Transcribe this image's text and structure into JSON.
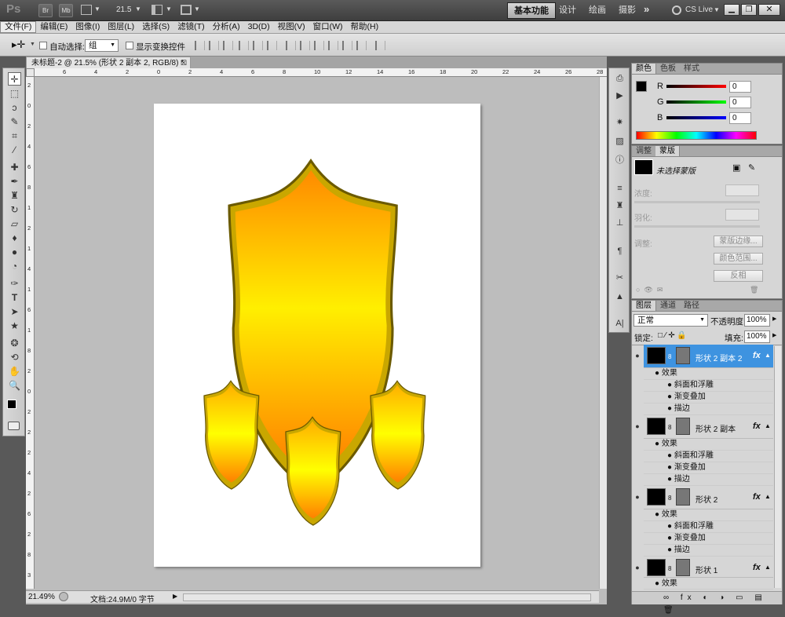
{
  "app": {
    "logo": "Ps",
    "zoom_display": "21.5",
    "cslive": "CS Live"
  },
  "topbar_buttons": [
    "Br",
    "Mb"
  ],
  "workspaces": [
    {
      "label": "基本功能",
      "active": true
    },
    {
      "label": "设计",
      "active": false
    },
    {
      "label": "绘画",
      "active": false
    },
    {
      "label": "摄影",
      "active": false
    }
  ],
  "menu": [
    "文件(F)",
    "编辑(E)",
    "图像(I)",
    "图层(L)",
    "选择(S)",
    "滤镜(T)",
    "分析(A)",
    "3D(D)",
    "视图(V)",
    "窗口(W)",
    "帮助(H)"
  ],
  "options": {
    "auto_select_label": "自动选择:",
    "auto_select_value": "组",
    "show_transform_label": "显示变换控件"
  },
  "document": {
    "tab_title": "未标题-2 @ 21.5% (形状 2 副本 2, RGB/8) *"
  },
  "rulers": {
    "h_ticks": [
      "6",
      "4",
      "2",
      "0",
      "2",
      "4",
      "6",
      "8",
      "10",
      "12",
      "14",
      "16",
      "18",
      "20",
      "22",
      "24",
      "26",
      "28"
    ],
    "v_ticks": [
      "2",
      "0",
      "2",
      "4",
      "6",
      "8",
      "1",
      "2",
      "1",
      "4",
      "1",
      "6",
      "1",
      "8",
      "2",
      "0",
      "2",
      "2",
      "2",
      "4",
      "2",
      "6",
      "2",
      "8",
      "3"
    ]
  },
  "status": {
    "zoom": "21.49%",
    "doc": "文档:24.9M/0 字节"
  },
  "color_panel": {
    "tabs": [
      {
        "label": "颜色",
        "active": true
      },
      {
        "label": "色板",
        "active": false
      },
      {
        "label": "样式",
        "active": false
      }
    ],
    "channels": [
      {
        "label": "R",
        "value": "0",
        "color": "#e00000"
      },
      {
        "label": "G",
        "value": "0",
        "color": "#00b000"
      },
      {
        "label": "B",
        "value": "0",
        "color": "#0000d0"
      }
    ]
  },
  "mask_panel": {
    "tabs": [
      {
        "label": "调整",
        "active": false
      },
      {
        "label": "蒙版",
        "active": true
      }
    ],
    "no_mask": "未选择蒙版",
    "density": "浓度:",
    "feather": "羽化:",
    "refine": "调整:",
    "buttons": [
      "蒙版边缘...",
      "颜色范围...",
      "反相"
    ]
  },
  "layers_panel": {
    "tabs": [
      {
        "label": "图层",
        "active": true
      },
      {
        "label": "通道",
        "active": false
      },
      {
        "label": "路径",
        "active": false
      }
    ],
    "blend_mode": "正常",
    "opacity_label": "不透明度:",
    "opacity": "100%",
    "lock_label": "锁定:",
    "fill_label": "填充:",
    "fill": "100%",
    "layers": [
      {
        "name": "形状 2 副本 2",
        "selected": true,
        "effects_label": "效果",
        "effects": [
          "斜面和浮雕",
          "渐变叠加",
          "描边"
        ]
      },
      {
        "name": "形状 2 副本",
        "selected": false,
        "effects_label": "效果",
        "effects": [
          "斜面和浮雕",
          "渐变叠加",
          "描边"
        ]
      },
      {
        "name": "形状 2",
        "selected": false,
        "effects_label": "效果",
        "effects": [
          "斜面和浮雕",
          "渐变叠加",
          "描边"
        ]
      },
      {
        "name": "形状 1",
        "selected": false,
        "effects_label": "效果",
        "effects": []
      }
    ]
  },
  "colors": {
    "accent": "#3e93e0",
    "shield_top": "#ff8a00",
    "shield_bottom": "#ffef00",
    "shield_stroke": "#b8a000"
  }
}
